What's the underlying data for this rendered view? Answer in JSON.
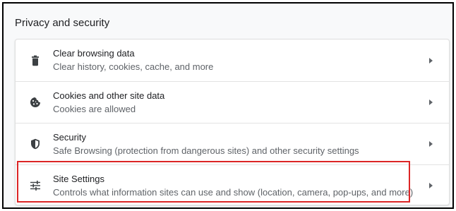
{
  "section": {
    "title": "Privacy and security"
  },
  "rows": [
    {
      "title": "Clear browsing data",
      "subtitle": "Clear history, cookies, cache, and more",
      "icon": "trash-icon"
    },
    {
      "title": "Cookies and other site data",
      "subtitle": "Cookies are allowed",
      "icon": "cookie-icon"
    },
    {
      "title": "Security",
      "subtitle": "Safe Browsing (protection from dangerous sites) and other security settings",
      "icon": "shield-icon"
    },
    {
      "title": "Site Settings",
      "subtitle": "Controls what information sites can use and show (location, camera, pop-ups, and more)",
      "icon": "sliders-icon"
    }
  ],
  "colors": {
    "highlight": "#dc2626",
    "text": "#202124",
    "secondary": "#5f6368",
    "icon": "#3c4043"
  }
}
